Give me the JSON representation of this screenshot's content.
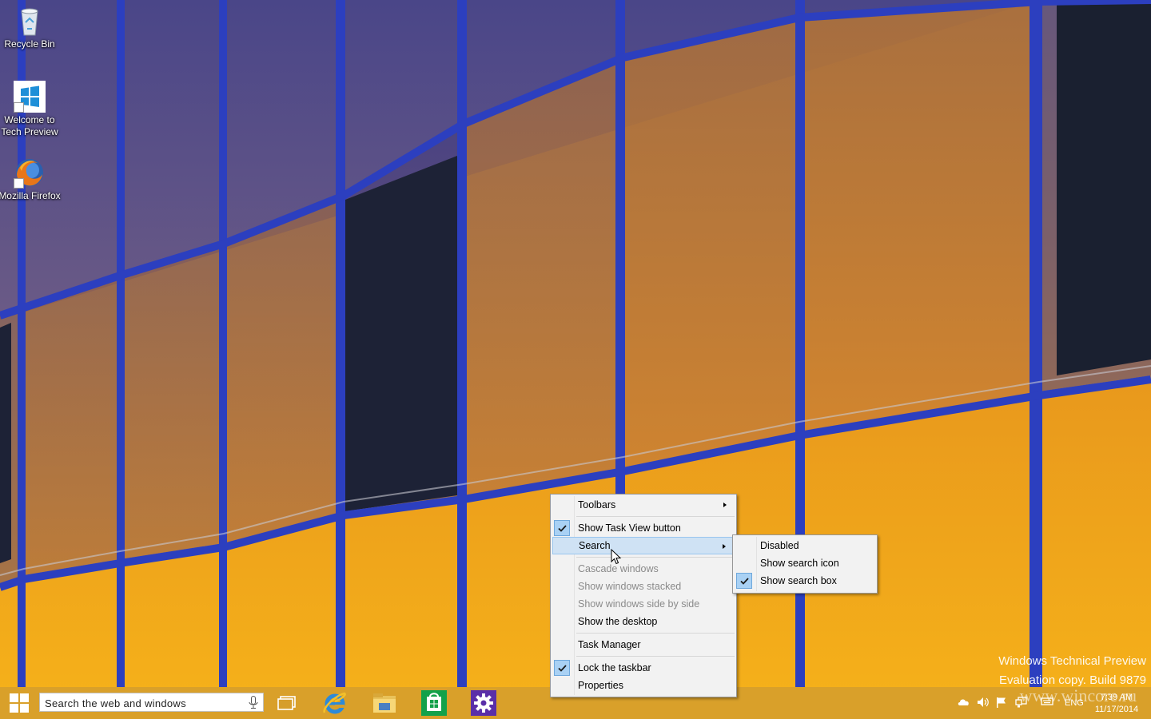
{
  "desktop": {
    "icons": [
      {
        "label": "Recycle Bin",
        "icon": "recycle-bin-icon"
      },
      {
        "label": "Welcome to Tech Preview",
        "icon": "windows-logo-icon"
      },
      {
        "label": "Mozilla Firefox",
        "icon": "firefox-icon"
      }
    ]
  },
  "watermark": {
    "line1": "Windows Technical Preview",
    "line2": "Evaluation copy. Build 9879",
    "site": "www.wincore.ru"
  },
  "taskbar": {
    "search_placeholder": "Search the web and windows",
    "pinned": [
      {
        "icon": "task-view-icon"
      },
      {
        "icon": "internet-explorer-icon"
      },
      {
        "icon": "file-explorer-icon"
      },
      {
        "icon": "store-icon"
      },
      {
        "icon": "settings-icon"
      }
    ],
    "tray": {
      "language": "ENG",
      "time": "7:39 AM",
      "date": "11/17/2014"
    }
  },
  "context_menu": {
    "items": {
      "toolbars": "Toolbars",
      "show_task_view": "Show Task View button",
      "search": "Search",
      "cascade": "Cascade windows",
      "stacked": "Show windows stacked",
      "side_by_side": "Show windows side by side",
      "show_desktop": "Show the desktop",
      "task_manager": "Task Manager",
      "lock_taskbar": "Lock the taskbar",
      "properties": "Properties"
    },
    "checked": [
      "Show Task View button",
      "Lock the taskbar"
    ],
    "disabled": [
      "Cascade windows",
      "Show windows stacked",
      "Show windows side by side"
    ],
    "highlighted": "Search"
  },
  "search_submenu": {
    "items": {
      "disabled": "Disabled",
      "show_icon": "Show search icon",
      "show_box": "Show search box"
    },
    "checked": "Show search box"
  },
  "colors": {
    "taskbar": "#d69e2c",
    "menu_highlight": "#cfe2f4",
    "check_bg": "#a9d1f4"
  }
}
